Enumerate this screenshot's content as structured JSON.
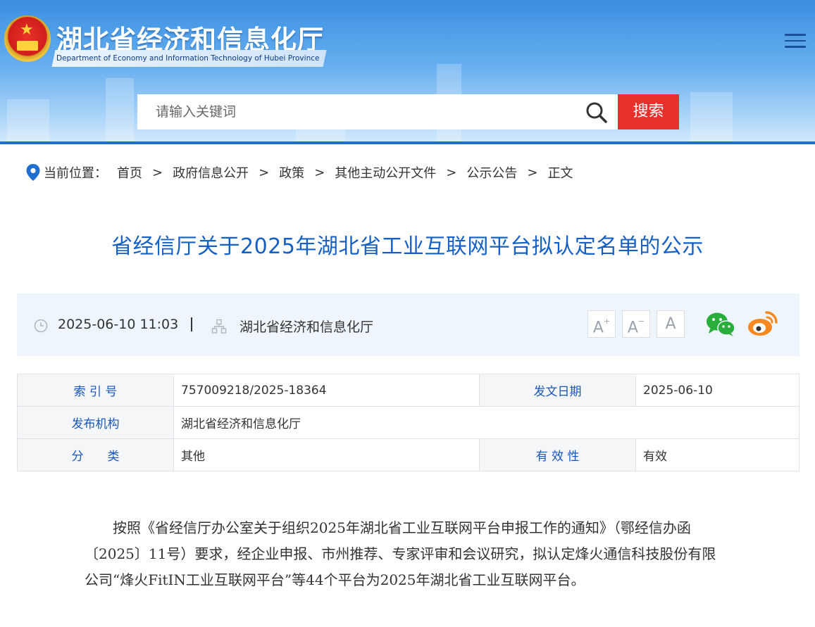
{
  "header": {
    "site_title": "湖北省经济和信息化厅",
    "site_subtitle": "Department of Economy and Information Technology of Hubei Province"
  },
  "search": {
    "placeholder": "请输入关键词",
    "button_label": "搜索"
  },
  "breadcrumb": {
    "label": "当前位置：",
    "items": [
      "首页",
      "政府信息公开",
      "政策",
      "其他主动公开文件",
      "公示公告",
      "正文"
    ],
    "separator": ">"
  },
  "article": {
    "title": "省经信厅关于2025年湖北省工业互联网平台拟认定名单的公示",
    "datetime": "2025-06-10 11:03",
    "source": "湖北省经济和信息化厅",
    "font_controls": {
      "larger": "A",
      "smaller": "A",
      "reset": "A"
    },
    "info_table": {
      "index_label": "索 引 号",
      "index_value": "757009218/2025-18364",
      "date_label": "发文日期",
      "date_value": "2025-06-10",
      "publisher_label": "发布机构",
      "publisher_value": "湖北省经济和信息化厅",
      "category_label": "分　　类",
      "category_value": "其他",
      "validity_label": "有 效 性",
      "validity_value": "有效"
    },
    "body": "按照《省经信厅办公室关于组织2025年湖北省工业互联网平台申报工作的通知》（鄂经信办函〔2025〕11号）要求，经企业申报、市州推荐、专家评审和会议研究，拟认定烽火通信科技股份有限公司“烽火FitIN工业互联网平台”等44个平台为2025年湖北省工业互联网平台。"
  },
  "icons": {
    "logo": "national-emblem",
    "menu": "hamburger-menu-icon",
    "search": "search-icon",
    "location": "location-pin-icon",
    "clock": "clock-icon",
    "org": "org-chart-icon",
    "wechat": "wechat-icon",
    "weibo": "weibo-icon"
  },
  "colors": {
    "title_blue": "#1560c4",
    "search_red": "#e8312c",
    "wechat_green": "#2aae3b",
    "weibo_orange": "#f5891f"
  }
}
